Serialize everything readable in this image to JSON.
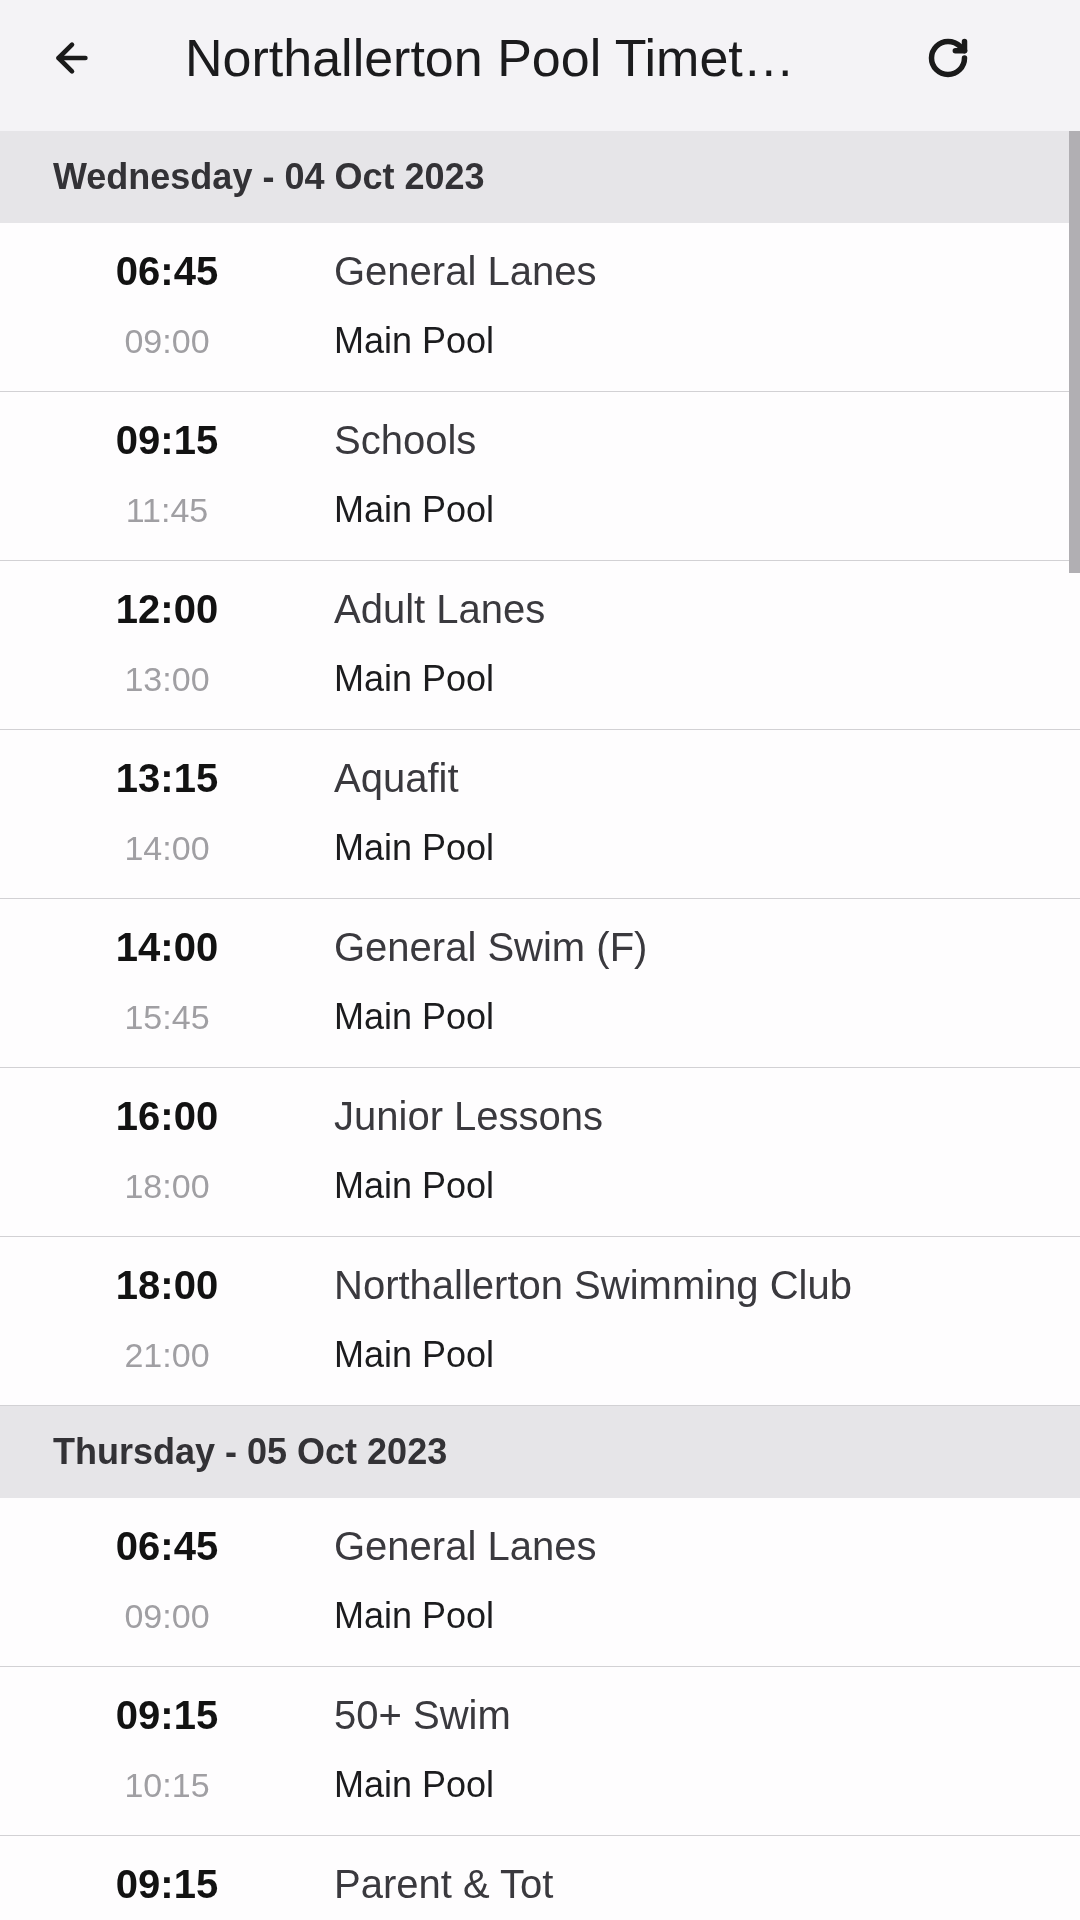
{
  "app_bar": {
    "title": "Northallerton Pool Timet…"
  },
  "days": [
    {
      "heading": "Wednesday - 04 Oct 2023",
      "sessions": [
        {
          "start": "06:45",
          "end": "09:00",
          "activity": "General Lanes",
          "location": "Main Pool"
        },
        {
          "start": "09:15",
          "end": "11:45",
          "activity": "Schools",
          "location": "Main Pool"
        },
        {
          "start": "12:00",
          "end": "13:00",
          "activity": "Adult Lanes",
          "location": "Main Pool"
        },
        {
          "start": "13:15",
          "end": "14:00",
          "activity": "Aquafit",
          "location": "Main Pool"
        },
        {
          "start": "14:00",
          "end": "15:45",
          "activity": "General Swim (F)",
          "location": "Main Pool"
        },
        {
          "start": "16:00",
          "end": "18:00",
          "activity": "Junior Lessons",
          "location": "Main Pool"
        },
        {
          "start": "18:00",
          "end": "21:00",
          "activity": "Northallerton Swimming Club",
          "location": "Main Pool"
        }
      ]
    },
    {
      "heading": "Thursday - 05 Oct 2023",
      "sessions": [
        {
          "start": "06:45",
          "end": "09:00",
          "activity": "General Lanes",
          "location": "Main Pool"
        },
        {
          "start": "09:15",
          "end": "10:15",
          "activity": "50+ Swim",
          "location": "Main Pool"
        },
        {
          "start": "09:15",
          "activity": "Parent & Tot"
        }
      ]
    }
  ]
}
